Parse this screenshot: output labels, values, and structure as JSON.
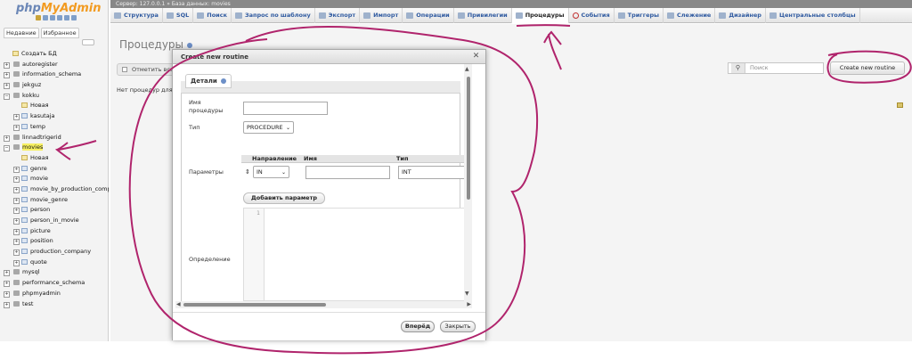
{
  "breadcrumb": "Сервер: 127.0.0.1 » База данных: movies",
  "logo": {
    "php": "php",
    "my": "MyAdmin"
  },
  "left_tabs": [
    "Недавние",
    "Избранное"
  ],
  "tree": {
    "create_db": "Создать БД",
    "items": [
      {
        "label": "autoregister"
      },
      {
        "label": "information_schema"
      },
      {
        "label": "jekguz"
      },
      {
        "label": "kokku"
      },
      {
        "label": "Новая",
        "child": true,
        "new": true
      },
      {
        "label": "kasutaja",
        "child": true
      },
      {
        "label": "temp",
        "child": true
      },
      {
        "label": "linnadtrigerid"
      },
      {
        "label": "movies",
        "highlight": true
      },
      {
        "label": "Новая",
        "child": true,
        "new": true
      },
      {
        "label": "genre",
        "child": true
      },
      {
        "label": "movie",
        "child": true
      },
      {
        "label": "movie_by_production_company",
        "child": true
      },
      {
        "label": "movie_genre",
        "child": true
      },
      {
        "label": "person",
        "child": true
      },
      {
        "label": "person_in_movie",
        "child": true
      },
      {
        "label": "picture",
        "child": true
      },
      {
        "label": "position",
        "child": true
      },
      {
        "label": "production_company",
        "child": true
      },
      {
        "label": "quote",
        "child": true
      },
      {
        "label": "mysql"
      },
      {
        "label": "performance_schema"
      },
      {
        "label": "phpmyadmin"
      },
      {
        "label": "test"
      }
    ]
  },
  "topnav": [
    {
      "label": "Структура",
      "icon": "structure-icon"
    },
    {
      "label": "SQL",
      "icon": "sql-icon"
    },
    {
      "label": "Поиск",
      "icon": "search-icon"
    },
    {
      "label": "Запрос по шаблону",
      "icon": "query-icon"
    },
    {
      "label": "Экспорт",
      "icon": "export-icon"
    },
    {
      "label": "Импорт",
      "icon": "import-icon"
    },
    {
      "label": "Операции",
      "icon": "wrench-icon"
    },
    {
      "label": "Привилегии",
      "icon": "privileges-icon"
    },
    {
      "label": "Процедуры",
      "icon": "routines-icon",
      "active": true
    },
    {
      "label": "События",
      "icon": "events-icon"
    },
    {
      "label": "Триггеры",
      "icon": "triggers-icon"
    },
    {
      "label": "Слежение",
      "icon": "tracking-icon"
    },
    {
      "label": "Дизайнер",
      "icon": "designer-icon"
    },
    {
      "label": "Центральные столбцы",
      "icon": "columns-icon"
    }
  ],
  "main": {
    "title": "Процедуры",
    "check_all": "Отметить все",
    "none_text": "Нет процедур для отображения.",
    "search_placeholder": "Поиск",
    "create_button": "Create new routine"
  },
  "dialog": {
    "title": "Create new routine",
    "legend": "Детали",
    "name_label": "Имя процедуры",
    "name_value": "",
    "type_label": "Тип",
    "type_value": "PROCEDURE",
    "params_label": "Параметры",
    "params_head": {
      "direction": "Направление",
      "name": "Имя",
      "type": "Тип"
    },
    "param_row": {
      "direction": "IN",
      "name": "",
      "type": "INT"
    },
    "add_param": "Добавить параметр",
    "definition_label": "Определение",
    "line_number": "1",
    "go_button": "Вперёд",
    "close_button": "Закрыть"
  }
}
